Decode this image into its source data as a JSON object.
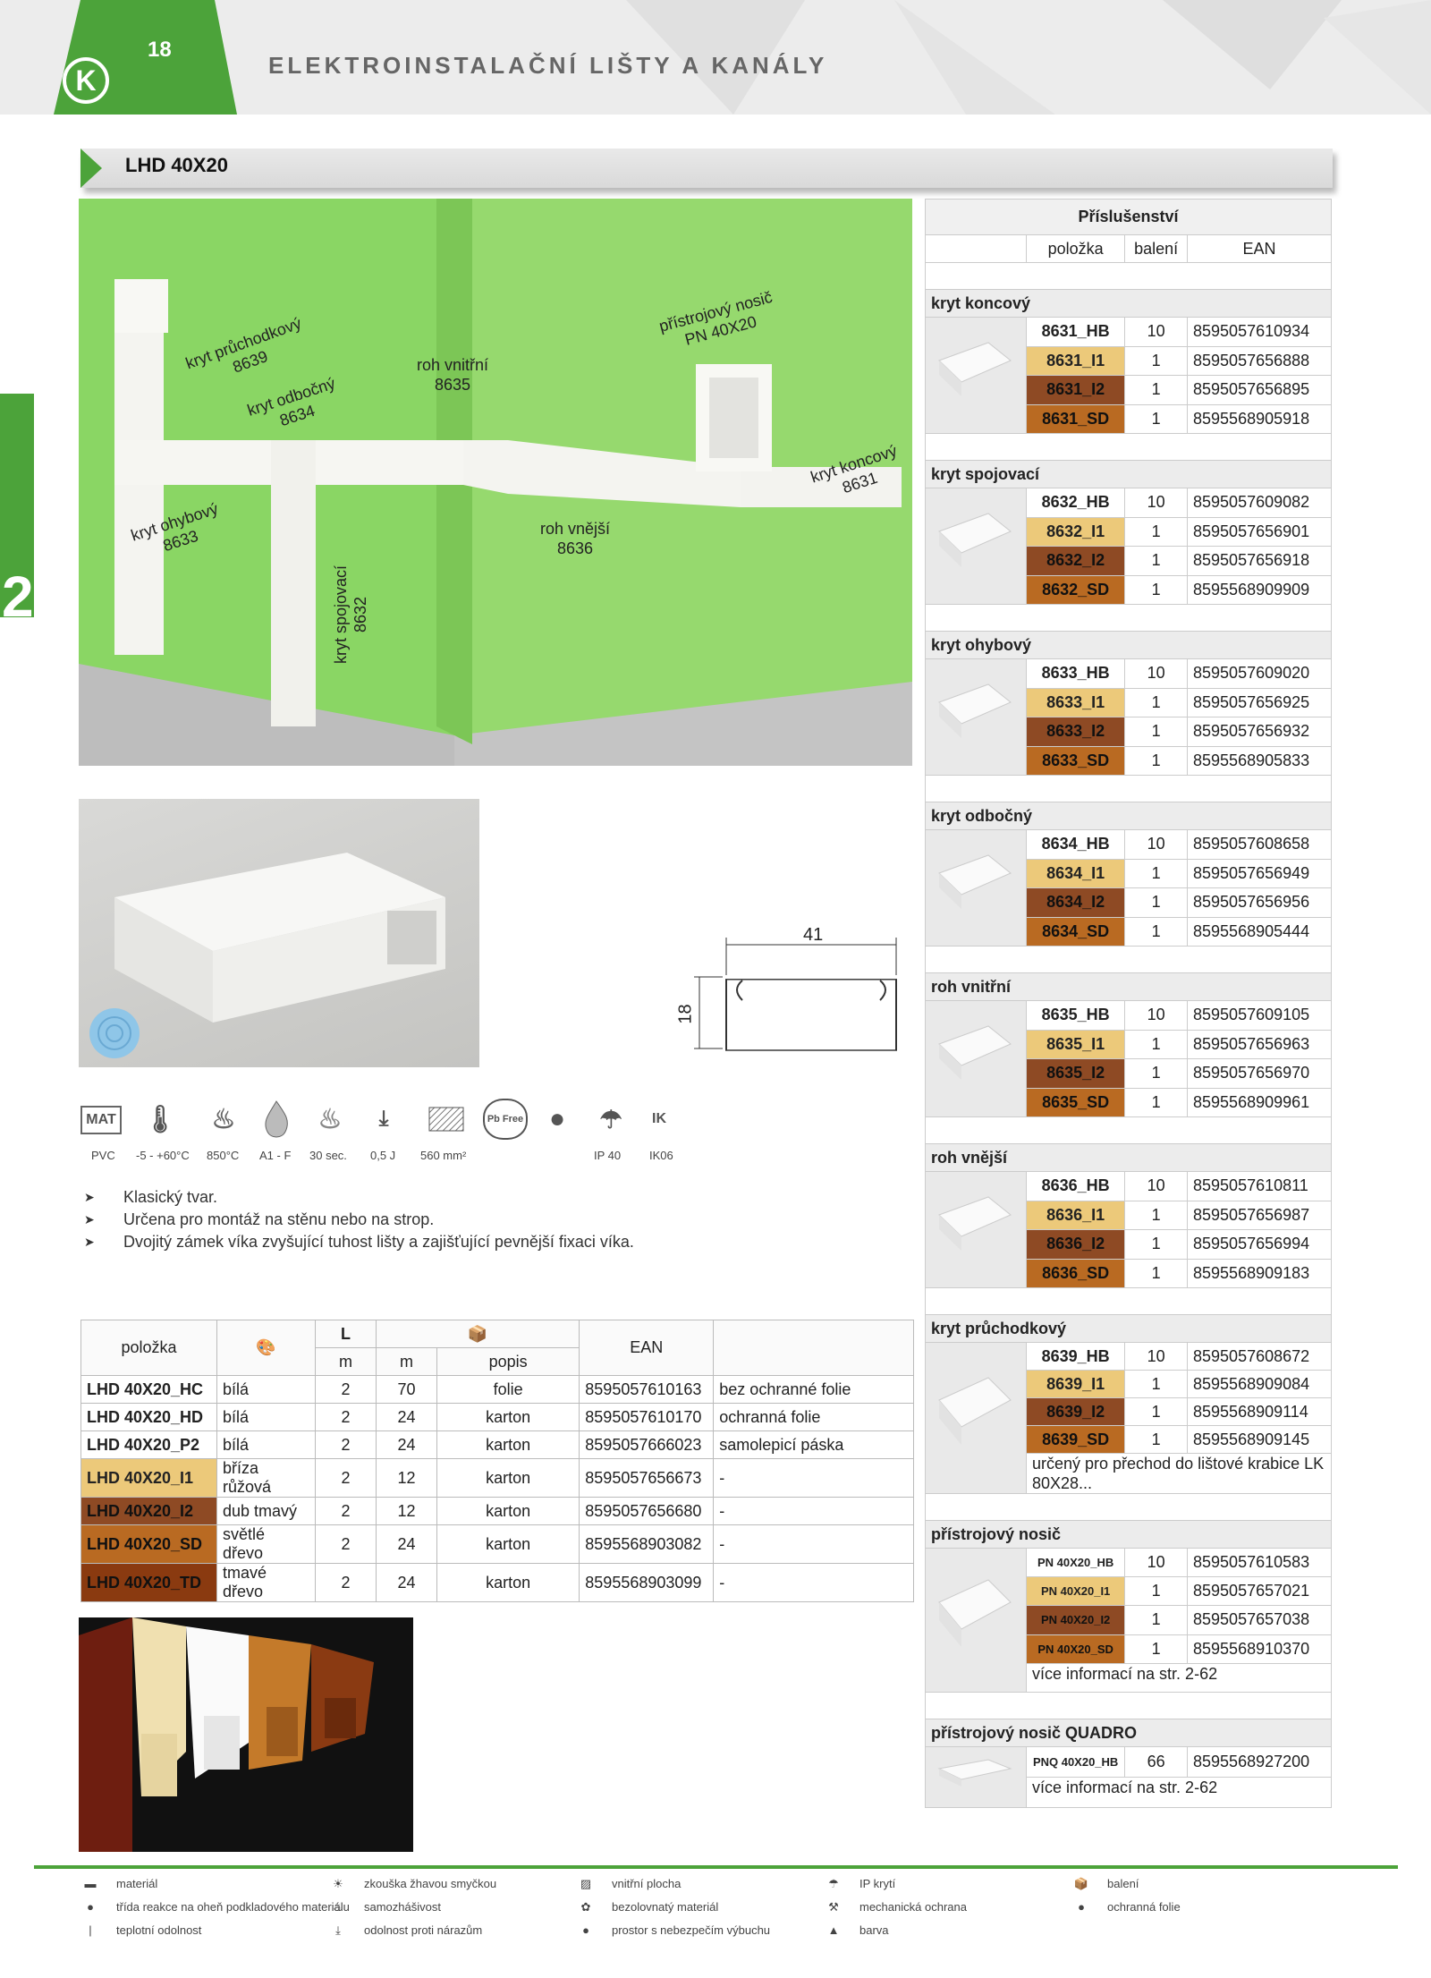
{
  "header": {
    "page_number": "18",
    "title": "ELEKTROINSTALAČNÍ LIŠTY A KANÁLY",
    "logo": "K",
    "side_number": "2"
  },
  "section": {
    "title": "LHD 40X20"
  },
  "photo_labels": {
    "pruchodkovy": "kryt průchodkový\n8639",
    "odbocny": "kryt odbočný\n8634",
    "vnitrni": "roh vnitřní\n8635",
    "nosic": "přístrojový nosič\nPN 40X20",
    "koncovy": "kryt koncový\n8631",
    "ohybovy": "kryt ohybový\n8633",
    "vnejsi": "roh vnější\n8636",
    "spojovaci": "kryt spojovací\n8632"
  },
  "drawing": {
    "width": "41",
    "height": "18"
  },
  "icons": [
    {
      "symbol": "MAT",
      "label": "PVC"
    },
    {
      "symbol": "thermometer-icon",
      "label": "-5 - +60°C"
    },
    {
      "symbol": "glow-wire-icon",
      "label": "850°C"
    },
    {
      "symbol": "flame-icon",
      "label": "A1 - F"
    },
    {
      "symbol": "self-extinguish-icon",
      "label": "30 sec."
    },
    {
      "symbol": "impact-icon",
      "label": "0,5 J"
    },
    {
      "symbol": "area-icon",
      "label": "560 mm²"
    },
    {
      "symbol": "Pb Free",
      "label": ""
    },
    {
      "symbol": "bomb-icon",
      "label": ""
    },
    {
      "symbol": "umbrella-icon",
      "label": "IP 40"
    },
    {
      "symbol": "IK",
      "label": "IK06"
    }
  ],
  "bullets": [
    "Klasický tvar.",
    "Určena pro montáž na stěnu nebo na strop.",
    "Dvojitý zámek víka zvyšující tuhost lišty a zajišťující pevnější fixaci víka."
  ],
  "product_table": {
    "headers": {
      "polozka": "položka",
      "L": "L",
      "m1": "m",
      "m2": "m",
      "popis": "popis",
      "ean": "EAN"
    },
    "rows": [
      {
        "code": "LHD 40X20_HC",
        "color": "bílá",
        "l": "2",
        "m": "70",
        "pack": "folie",
        "ean": "8595057610163",
        "note": "bez ochranné folie",
        "tone": "hb"
      },
      {
        "code": "LHD 40X20_HD",
        "color": "bílá",
        "l": "2",
        "m": "24",
        "pack": "karton",
        "ean": "8595057610170",
        "note": "ochranná folie",
        "tone": "hb"
      },
      {
        "code": "LHD 40X20_P2",
        "color": "bílá",
        "l": "2",
        "m": "24",
        "pack": "karton",
        "ean": "8595057666023",
        "note": "samolepicí páska",
        "tone": "hb"
      },
      {
        "code": "LHD 40X20_I1",
        "color": "bříza růžová",
        "l": "2",
        "m": "12",
        "pack": "karton",
        "ean": "8595057656673",
        "note": "-",
        "tone": "i1"
      },
      {
        "code": "LHD 40X20_I2",
        "color": "dub tmavý",
        "l": "2",
        "m": "12",
        "pack": "karton",
        "ean": "8595057656680",
        "note": "-",
        "tone": "i2"
      },
      {
        "code": "LHD 40X20_SD",
        "color": "světlé dřevo",
        "l": "2",
        "m": "24",
        "pack": "karton",
        "ean": "8595568903082",
        "note": "-",
        "tone": "sd"
      },
      {
        "code": "LHD 40X20_TD",
        "color": "tmavé dřevo",
        "l": "2",
        "m": "24",
        "pack": "karton",
        "ean": "8595568903099",
        "note": "-",
        "tone": "td"
      }
    ]
  },
  "accessories": {
    "title": "Příslušenství",
    "col_item": "položka",
    "col_pack": "balení",
    "col_ean": "EAN",
    "groups": [
      {
        "name": "kryt koncový",
        "items": [
          {
            "code": "8631_HB",
            "qty": "10",
            "ean": "8595057610934",
            "tone": "hb"
          },
          {
            "code": "8631_I1",
            "qty": "1",
            "ean": "8595057656888",
            "tone": "i1"
          },
          {
            "code": "8631_I2",
            "qty": "1",
            "ean": "8595057656895",
            "tone": "i2"
          },
          {
            "code": "8631_SD",
            "qty": "1",
            "ean": "8595568905918",
            "tone": "sd"
          }
        ]
      },
      {
        "name": "kryt spojovací",
        "items": [
          {
            "code": "8632_HB",
            "qty": "10",
            "ean": "8595057609082",
            "tone": "hb"
          },
          {
            "code": "8632_I1",
            "qty": "1",
            "ean": "8595057656901",
            "tone": "i1"
          },
          {
            "code": "8632_I2",
            "qty": "1",
            "ean": "8595057656918",
            "tone": "i2"
          },
          {
            "code": "8632_SD",
            "qty": "1",
            "ean": "8595568909909",
            "tone": "sd"
          }
        ]
      },
      {
        "name": "kryt ohybový",
        "items": [
          {
            "code": "8633_HB",
            "qty": "10",
            "ean": "8595057609020",
            "tone": "hb"
          },
          {
            "code": "8633_I1",
            "qty": "1",
            "ean": "8595057656925",
            "tone": "i1"
          },
          {
            "code": "8633_I2",
            "qty": "1",
            "ean": "8595057656932",
            "tone": "i2"
          },
          {
            "code": "8633_SD",
            "qty": "1",
            "ean": "8595568905833",
            "tone": "sd"
          }
        ]
      },
      {
        "name": "kryt odbočný",
        "items": [
          {
            "code": "8634_HB",
            "qty": "10",
            "ean": "8595057608658",
            "tone": "hb"
          },
          {
            "code": "8634_I1",
            "qty": "1",
            "ean": "8595057656949",
            "tone": "i1"
          },
          {
            "code": "8634_I2",
            "qty": "1",
            "ean": "8595057656956",
            "tone": "i2"
          },
          {
            "code": "8634_SD",
            "qty": "1",
            "ean": "8595568905444",
            "tone": "sd"
          }
        ]
      },
      {
        "name": "roh vnitřní",
        "items": [
          {
            "code": "8635_HB",
            "qty": "10",
            "ean": "8595057609105",
            "tone": "hb"
          },
          {
            "code": "8635_I1",
            "qty": "1",
            "ean": "8595057656963",
            "tone": "i1"
          },
          {
            "code": "8635_I2",
            "qty": "1",
            "ean": "8595057656970",
            "tone": "i2"
          },
          {
            "code": "8635_SD",
            "qty": "1",
            "ean": "8595568909961",
            "tone": "sd"
          }
        ]
      },
      {
        "name": "roh vnější",
        "items": [
          {
            "code": "8636_HB",
            "qty": "10",
            "ean": "8595057610811",
            "tone": "hb"
          },
          {
            "code": "8636_I1",
            "qty": "1",
            "ean": "8595057656987",
            "tone": "i1"
          },
          {
            "code": "8636_I2",
            "qty": "1",
            "ean": "8595057656994",
            "tone": "i2"
          },
          {
            "code": "8636_SD",
            "qty": "1",
            "ean": "8595568909183",
            "tone": "sd"
          }
        ]
      },
      {
        "name": "kryt průchodkový",
        "items": [
          {
            "code": "8639_HB",
            "qty": "10",
            "ean": "8595057608672",
            "tone": "hb"
          },
          {
            "code": "8639_I1",
            "qty": "1",
            "ean": "8595568909084",
            "tone": "i1"
          },
          {
            "code": "8639_I2",
            "qty": "1",
            "ean": "8595568909114",
            "tone": "i2"
          },
          {
            "code": "8639_SD",
            "qty": "1",
            "ean": "8595568909145",
            "tone": "sd"
          }
        ],
        "note": "určený pro přechod do lištové krabice LK 80X28..."
      },
      {
        "name": "přístrojový nosič",
        "small": true,
        "items": [
          {
            "code": "PN 40X20_HB",
            "qty": "10",
            "ean": "8595057610583",
            "tone": "hb"
          },
          {
            "code": "PN 40X20_I1",
            "qty": "1",
            "ean": "8595057657021",
            "tone": "i1"
          },
          {
            "code": "PN 40X20_I2",
            "qty": "1",
            "ean": "8595057657038",
            "tone": "i2"
          },
          {
            "code": "PN 40X20_SD",
            "qty": "1",
            "ean": "8595568910370",
            "tone": "sd"
          }
        ],
        "note": "více informací na str. 2-62"
      },
      {
        "name": "přístrojový nosič QUADRO",
        "small": true,
        "items": [
          {
            "code": "PNQ 40X20_HB",
            "qty": "66",
            "ean": "8595568927200",
            "tone": "hb"
          }
        ],
        "note": "více informací na str. 2-62"
      }
    ]
  },
  "legend": [
    [
      "materiál",
      "zkouška žhavou smyčkou",
      "vnitřní plocha",
      "IP krytí",
      "balení"
    ],
    [
      "třída reakce na oheň podkladového materiálu",
      "samozhášivost",
      "bezolovnatý materiál",
      "mechanická ochrana",
      "ochranná folie"
    ],
    [
      "teplotní odolnost",
      "odolnost proti nárazům",
      "prostor s nebezpečím výbuchu",
      "barva",
      ""
    ]
  ],
  "colors": {
    "green": "#4ca33a",
    "wall": "#8fd46b"
  }
}
